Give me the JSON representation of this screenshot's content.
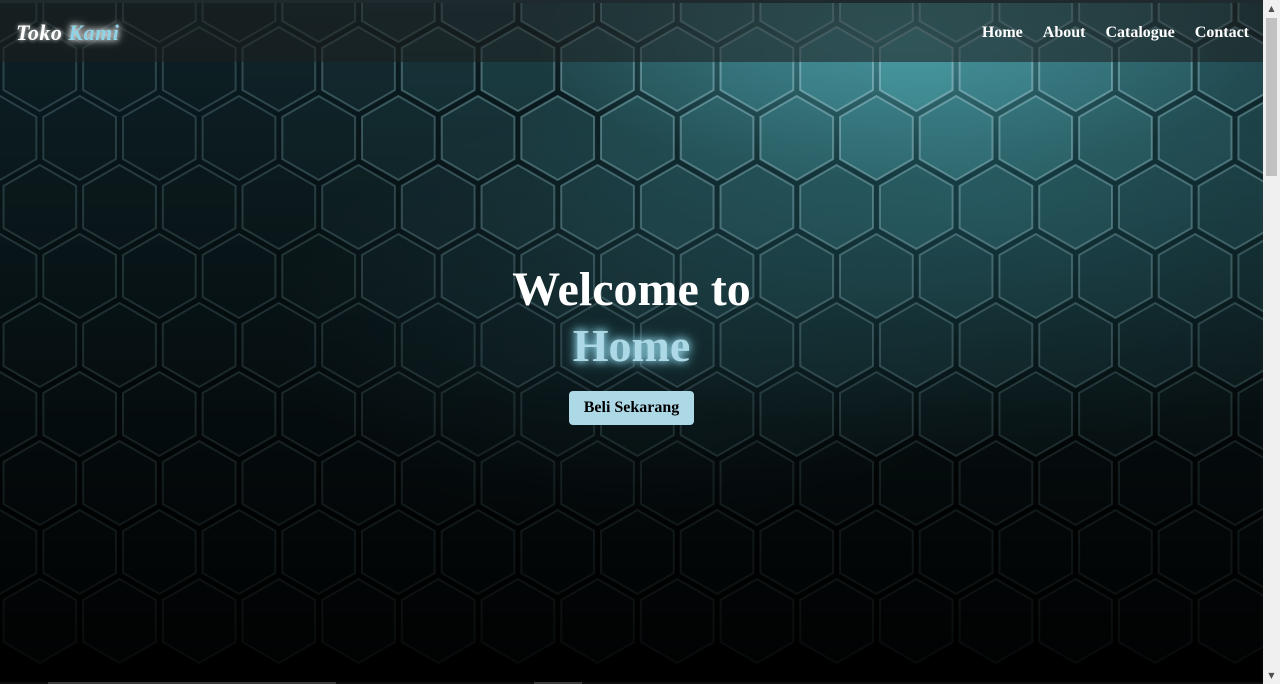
{
  "brand": {
    "part1": "Toko",
    "part2": "Kami"
  },
  "nav": {
    "items": [
      {
        "label": "Home"
      },
      {
        "label": "About"
      },
      {
        "label": "Catalogue"
      },
      {
        "label": "Contact"
      }
    ]
  },
  "hero": {
    "title": "Welcome to",
    "subtitle": "Home",
    "cta_label": "Beli Sekarang"
  },
  "colors": {
    "accent": "#add8e6",
    "nav_text": "#ffffff",
    "background_tint": "#0b1f24"
  },
  "scrollbar": {
    "up_icon": "scroll-up-arrow",
    "down_icon": "scroll-down-arrow"
  }
}
